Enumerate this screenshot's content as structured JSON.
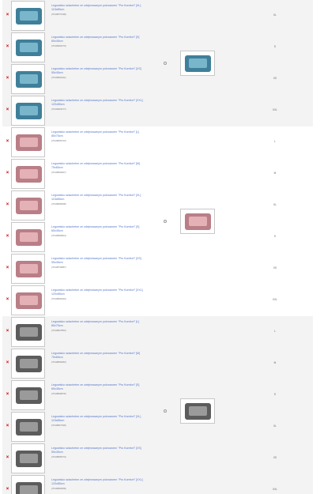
{
  "colors": {
    "blue": "#3f7f99",
    "pink": "#b97e86",
    "grey": "#5c5c5c",
    "link": "#5577cc",
    "delete": "#cc0000"
  },
  "icons": {
    "delete": "x-icon",
    "radio": "radio-button"
  },
  "groups": [
    {
      "color": "blue",
      "rows": [
        {
          "title": "Legowisko szlachetne ze zdejmowanym pokrowcem \"Pro Komfort\" [XL] 115x85cm",
          "sku": "(7010877048)",
          "size": "XL"
        },
        {
          "title": "Legowisko szlachetne ze zdejmowanym pokrowcem \"Pro Komfort\" [S] 65x45cm",
          "sku": "(7010962273)",
          "size": "S"
        },
        {
          "title": "Legowisko szlachetne ze zdejmowanym pokrowcem \"Pro Komfort\" [XS] 55x45cm",
          "sku": "(7010962341)",
          "size": "XS"
        },
        {
          "title": "Legowisko szlachetne ze zdejmowanym pokrowcem \"Pro Komfort\" [XXL] 120x85cm",
          "sku": "(7010963277)",
          "size": "XXL"
        }
      ]
    },
    {
      "color": "pink",
      "rows": [
        {
          "title": "Legowisko szlachetne ze zdejmowanym pokrowcem \"Pro Komfort\" [L] 85x75cm",
          "sku": "(7010869723)",
          "size": "L"
        },
        {
          "title": "Legowisko szlachetne ze zdejmowanym pokrowcem \"Pro Komfort\" [M] 75x65cm",
          "sku": "(7010869367)",
          "size": "M"
        },
        {
          "title": "Legowisko szlachetne ze zdejmowanym pokrowcem \"Pro Komfort\" [XL] 115x85cm",
          "sku": "(7010869938)",
          "size": "XL"
        },
        {
          "title": "Legowisko szlachetne ze zdejmowanym pokrowcem \"Pro Komfort\" [S] 65x45cm",
          "sku": "(7010869904)",
          "size": "S"
        },
        {
          "title": "Legowisko szlachetne ze zdejmowanym pokrowcem \"Pro Komfort\" [XS] 55x45cm",
          "sku": "(7010870987)",
          "size": "XS"
        },
        {
          "title": "Legowisko szlachetne ze zdejmowanym pokrowcem \"Pro Komfort\" [XXL] 120x85cm",
          "sku": "(7010869193)",
          "size": "XXL"
        }
      ]
    },
    {
      "color": "grey",
      "rows": [
        {
          "title": "Legowisko szlachetne ze zdejmowanym pokrowcem \"Pro Komfort\" [L] 85x75cm",
          "sku": "(7010867853)",
          "size": "L"
        },
        {
          "title": "Legowisko szlachetne ze zdejmowanym pokrowcem \"Pro Komfort\" [M] 75x65cm",
          "sku": "(7010866283)",
          "size": "M"
        },
        {
          "title": "Legowisko szlachetne ze zdejmowanym pokrowcem \"Pro Komfort\" [S] 65x45cm",
          "sku": "(7010866879)",
          "size": "S"
        },
        {
          "title": "Legowisko szlachetne ze zdejmowanym pokrowcem \"Pro Komfort\" [XL] 115x85cm",
          "sku": "(7010867339)",
          "size": "XL"
        },
        {
          "title": "Legowisko szlachetne ze zdejmowanym pokrowcem \"Pro Komfort\" [XS] 55x45cm",
          "sku": "(7010865373)",
          "size": "XS"
        },
        {
          "title": "Legowisko szlachetne ze zdejmowanym pokrowcem \"Pro Komfort\" [XXL] 120x85cm",
          "sku": "(7010866458)",
          "size": "XXL"
        }
      ]
    }
  ]
}
